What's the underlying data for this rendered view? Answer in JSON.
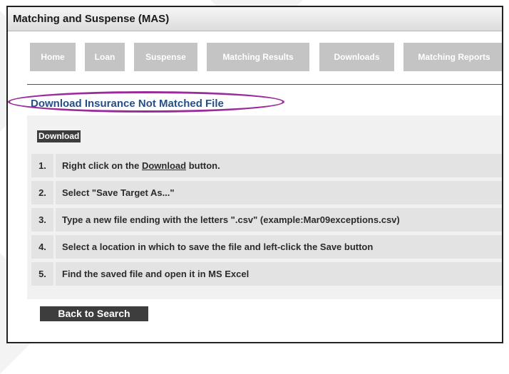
{
  "window": {
    "title": "Matching and Suspense (MAS)"
  },
  "nav": {
    "tabs": [
      {
        "label": "Home"
      },
      {
        "label": "Loan"
      },
      {
        "label": "Suspense"
      },
      {
        "label": "Matching Results"
      },
      {
        "label": "Downloads"
      },
      {
        "label": "Matching Reports"
      }
    ]
  },
  "page": {
    "heading": "Download Insurance Not Matched File",
    "download_link": "Download",
    "steps": [
      {
        "num": "1.",
        "before": "Right click on the ",
        "link": "Download",
        "after": " button."
      },
      {
        "num": "2.",
        "text": "Select \"Save Target As...\""
      },
      {
        "num": "3.",
        "text": "Type a new file ending with the letters \".csv\" (example:Mar09exceptions.csv)"
      },
      {
        "num": "4.",
        "text": "Select a location in which to save the file and left-click the Save button"
      },
      {
        "num": "5.",
        "text": "Find the saved file and open it in MS Excel"
      }
    ],
    "back_button": "Back to Search"
  },
  "colors": {
    "heading": "#244f88",
    "highlight": "#9b2b9b",
    "tab_bg": "#c4c4c4",
    "button_bg": "#3d3d3d"
  }
}
